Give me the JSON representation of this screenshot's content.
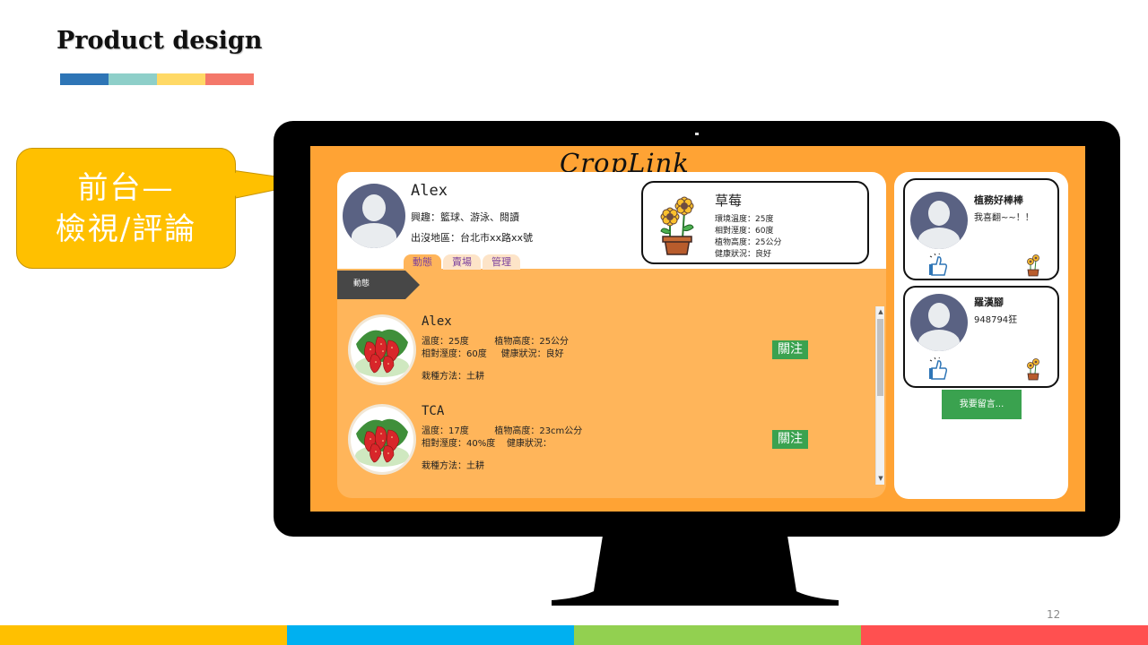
{
  "slide": {
    "title": "Product design",
    "page_number": "12"
  },
  "colors": {
    "stripe": [
      "#2E75B6",
      "#8ECFC9",
      "#FFD966",
      "#F4786A"
    ],
    "bottom_bar": [
      "#FFC000",
      "#00B0F0",
      "#92D050",
      "#FF5050"
    ],
    "callout": "#FFC000",
    "screen_bg": "#FFA334",
    "feed_bg": "#FFB55A",
    "button_green": "#3AA24F",
    "avatar": "#5A6283"
  },
  "callout": {
    "line1": "前台—",
    "line2": "檢視/評論"
  },
  "app": {
    "brand": "CropLink",
    "profile": {
      "name": "Alex",
      "interests": "興趣：籃球、游泳、閱讀",
      "area": "出沒地區：台北市xx路xx號"
    },
    "tabs": [
      {
        "label": "動態",
        "active": true
      },
      {
        "label": "賣場",
        "active": false
      },
      {
        "label": "管理",
        "active": false
      }
    ],
    "plant_card": {
      "name": "草莓",
      "lines": [
        "環境溫度：25度",
        "相對溼度：60度",
        "植物高度：25公分",
        "健康狀況：良好"
      ]
    },
    "feed_label": "動態",
    "posts": [
      {
        "name": "Alex",
        "line1": "溫度：25度         植物高度：25公分",
        "line2": "相對溼度：60度     健康狀況：良好",
        "line3": "栽種方法：土耕",
        "follow": "關注"
      },
      {
        "name": "TCA",
        "line1": "溫度：17度         植物高度：23cm公分",
        "line2": "相對溼度：40%度    健康狀況：",
        "line3": "栽種方法：土耕",
        "follow": "關注"
      }
    ],
    "comments": [
      {
        "name": "植務好棒棒",
        "text": "我喜翻~~！！"
      },
      {
        "name": "羅漢腳",
        "text": "948794狂"
      }
    ],
    "reply_button": "我要留言..."
  }
}
